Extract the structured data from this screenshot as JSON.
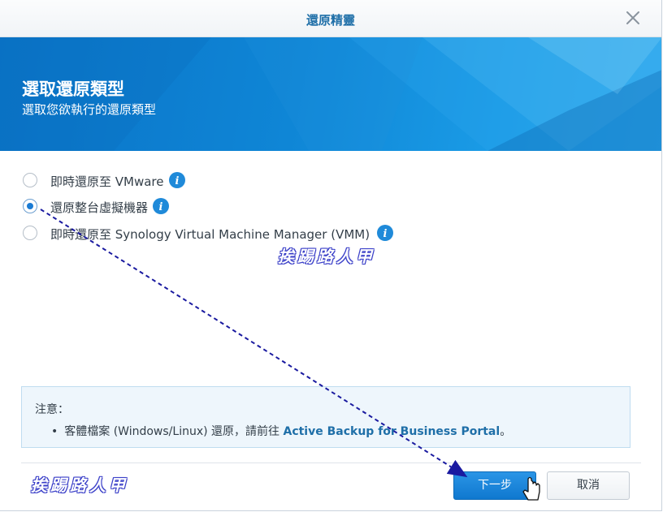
{
  "window": {
    "title": "還原精靈"
  },
  "banner": {
    "heading": "選取還原類型",
    "subheading": "選取您欲執行的還原類型"
  },
  "options": [
    {
      "label": "即時還原至 VMware",
      "checked": false
    },
    {
      "label": "還原整台虛擬機器",
      "checked": true
    },
    {
      "label": "即時還原至 Synology Virtual Machine Manager (VMM)",
      "checked": false
    }
  ],
  "note": {
    "title": "注意：",
    "bullet": "•",
    "text_before": "客體檔案 (Windows/Linux) 還原，請前往 ",
    "link": "Active Backup for Business Portal",
    "text_after": "。"
  },
  "buttons": {
    "next": "下一步",
    "cancel": "取消"
  },
  "watermark": {
    "text": "挨踢路人甲"
  },
  "colors": {
    "accent": "#0f78cf",
    "annotation_arrow": "#1a1aa0"
  },
  "icons": {
    "close": "close-icon",
    "info": "info-icon",
    "cursor": "hand-cursor-icon"
  }
}
